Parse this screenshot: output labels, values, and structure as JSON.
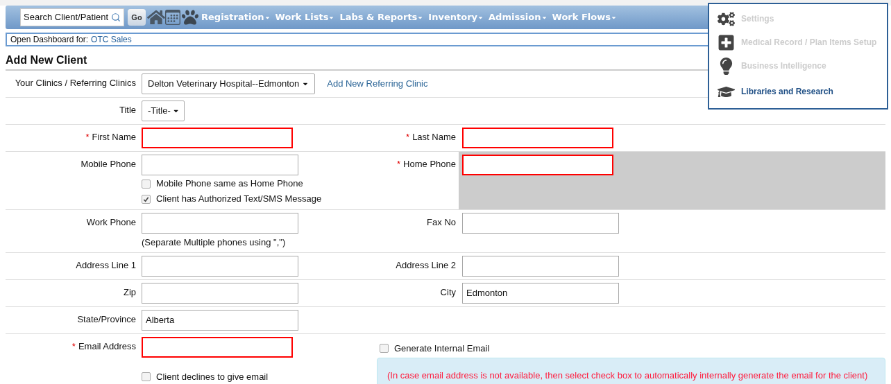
{
  "nav": {
    "search": {
      "placeholder": "Search Client/Patient"
    },
    "go": "Go",
    "menus": [
      "Registration",
      "Work Lists",
      "Labs & Reports",
      "Inventory",
      "Admission",
      "Work Flows"
    ]
  },
  "dashboard": {
    "label": "Open Dashboard for:",
    "link": "OTC Sales"
  },
  "page_title": "Add New Client",
  "rows": [
    {
      "left": {
        "label": "Your Clinics / Referring Clinics",
        "kind": "select",
        "value": "Delton Veterinary Hospital--Edmonton",
        "link": "Add New Referring Clinic"
      }
    },
    {
      "left": {
        "label": "Title",
        "kind": "small_select",
        "value": "-Title-"
      }
    },
    {
      "left": {
        "label": "First Name",
        "marker": "*",
        "kind": "text"
      },
      "right": {
        "label": "Last Name",
        "marker": "*",
        "kind": "text",
        "shaded": false
      }
    },
    {
      "left": {
        "label": "Mobile Phone",
        "kind": "text",
        "checkboxes": [
          {
            "label": "Mobile Phone same as Home Phone",
            "checked": false
          },
          {
            "label": "Client has Authorized Text/SMS Message",
            "checked": true
          }
        ]
      },
      "right": {
        "label": "Home Phone",
        "marker": "*",
        "kind": "text",
        "shaded": true
      }
    },
    {
      "left": {
        "label": "Work Phone",
        "kind": "text",
        "note": "(Separate Multiple phones using \",\")"
      },
      "right": {
        "label": "Fax No",
        "kind": "text",
        "shaded": false
      }
    },
    {
      "left": {
        "label": "Address Line 1",
        "kind": "text"
      },
      "right": {
        "label": "Address Line 2",
        "kind": "text",
        "shaded": false
      }
    },
    {
      "left": {
        "label": "Zip",
        "kind": "text"
      },
      "right": {
        "label": "City",
        "kind": "text",
        "value": "Edmonton",
        "shaded": false
      }
    },
    {
      "left": {
        "label": "State/Province",
        "kind": "text",
        "value": "Alberta"
      }
    },
    {
      "left": {
        "label": "Email Address",
        "marker": "*",
        "kind": "text",
        "checkboxes": [
          {
            "label": "Client declines to give email",
            "checked": false
          }
        ]
      },
      "right": {
        "kind": "checkbox_note",
        "checkbox": {
          "label": "Generate Internal Email",
          "checked": false
        },
        "info": "(In case email address is not available, then select check box to automatically internally generate the email for the client)"
      }
    }
  ],
  "menu": {
    "items": [
      {
        "label": "Settings",
        "kind": "gears",
        "disabled": true
      },
      {
        "label": "Medical Record / Plan Items Setup",
        "kind": "plus",
        "disabled": true
      },
      {
        "label": "Business Intelligence",
        "kind": "bulb",
        "disabled": true
      },
      {
        "label": "Libraries and Research",
        "kind": "cap",
        "disabled": false
      }
    ]
  }
}
